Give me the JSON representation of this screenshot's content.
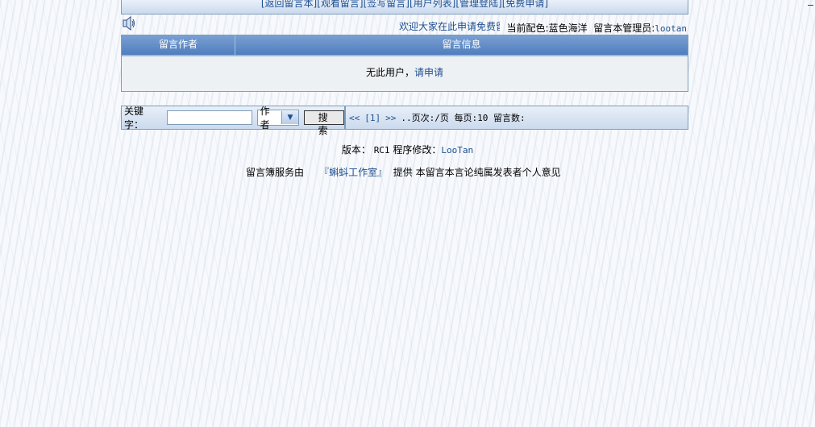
{
  "nav": {
    "items": [
      "[返回留言本]",
      "[观看留言]",
      "[签写留言]",
      "[用户列表]",
      "[管理登陆]",
      "[免费申请]"
    ]
  },
  "welcome": {
    "marquee": "欢迎大家在此申请免费留言本",
    "scheme_label": "当前配色:",
    "scheme_value": "蓝色海洋",
    "admin_label": "留言本管理员:",
    "admin_name": "lootan"
  },
  "table": {
    "col_author": "留言作者",
    "col_info": "留言信息",
    "message_prefix": "无此用户，",
    "message_link": "请申请"
  },
  "search": {
    "keyword_label": "关键字：",
    "keyword_value": "",
    "select_value": "作者",
    "button_label": "搜 索",
    "first": "<<",
    "page": "[1]",
    "last": ">>",
    "info": "..页次:/页 每页:10 留言数:"
  },
  "footer": {
    "version_label": "版本：",
    "version_value": "RC1",
    "modify_label": "程序修改：",
    "modify_name": "LooTan",
    "service_prefix": "留言簿服务由",
    "studio": "『蝌蚪工作室』",
    "service_suffix": "提供 本留言本言论纯属发表者个人意见"
  }
}
